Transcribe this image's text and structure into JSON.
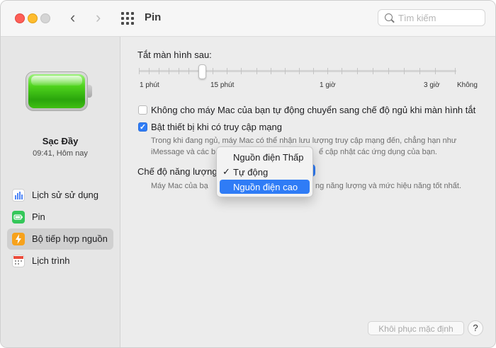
{
  "window": {
    "title": "Pin",
    "search_placeholder": "Tìm kiếm"
  },
  "sidebar": {
    "battery_status": "Sạc Đầy",
    "battery_time": "09:41, Hôm nay",
    "items": [
      {
        "label": "Lịch sử sử dụng",
        "icon": "usage-history-icon",
        "color": "#4f86f7"
      },
      {
        "label": "Pin",
        "icon": "battery-icon",
        "color": "#34c759"
      },
      {
        "label": "Bộ tiếp hợp nguồn",
        "icon": "power-adapter-icon",
        "color": "#f7a21b",
        "selected": true
      },
      {
        "label": "Lịch trình",
        "icon": "calendar-icon",
        "color": "#ea4c3c"
      }
    ]
  },
  "main": {
    "turn_off_label": "Tắt màn hình sau:",
    "slider_ticks": [
      "1 phút",
      "15 phút",
      "1 giờ",
      "3 giờ",
      "Không"
    ],
    "slider_value": "15 phút",
    "prevent_sleep_label": "Không cho máy Mac của bạn tự động chuyển sang chế độ ngủ khi màn hình tắt",
    "prevent_sleep_checked": false,
    "wake_network_label": "Bật thiết bị khi có truy cập mạng",
    "wake_network_checked": true,
    "wake_network_desc_line1": "Trong khi đang ngủ, máy Mac có thể nhận lưu lượng truy cập mạng đến, chẳng hạn như",
    "wake_network_desc_line2_a": "iMessage và các b",
    "wake_network_desc_line2_b": "ể cập nhật các ứng dụng của bạn.",
    "energy_mode_label": "Chế độ năng lượng",
    "energy_mode_desc_a": "Máy Mac của bạ",
    "energy_mode_desc_b": "ng năng lượng và mức hiệu năng tốt nhất.",
    "restore_button": "Khôi phục mặc định",
    "help_button": "?"
  },
  "energy_menu": {
    "options": [
      "Nguồn điện Thấp",
      "Tự động",
      "Nguồn điện cao"
    ],
    "checked": "Tự động",
    "highlighted": "Nguồn điện cao",
    "check_mark": "✓"
  }
}
